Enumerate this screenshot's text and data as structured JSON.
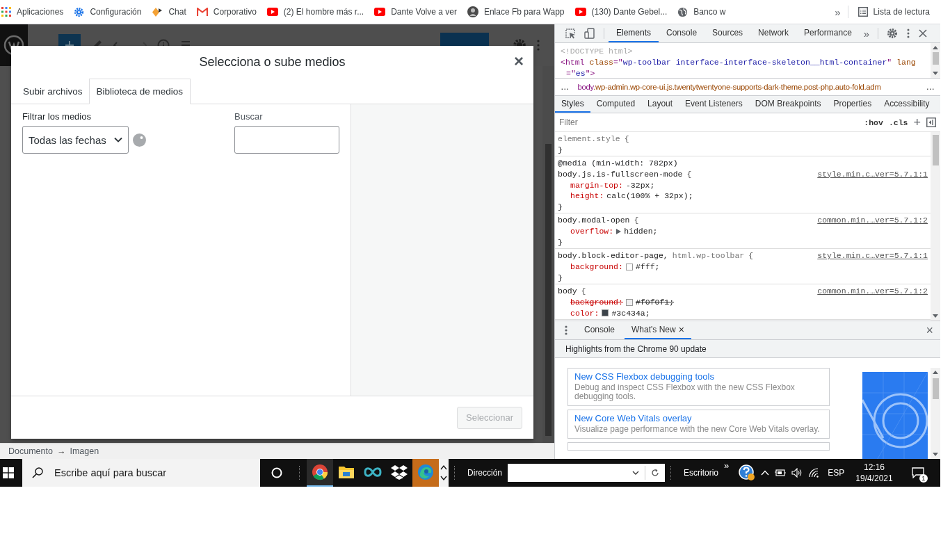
{
  "bookmarks": {
    "items": [
      {
        "label": "Aplicaciones",
        "kind": "grid"
      },
      {
        "label": "Configuración",
        "kind": "gear"
      },
      {
        "label": "Chat",
        "kind": "chat"
      },
      {
        "label": "Corporativo",
        "kind": "mail"
      },
      {
        "label": "(2) El hombre más r...",
        "kind": "video"
      },
      {
        "label": "Dante Volve a ver",
        "kind": "video"
      },
      {
        "label": "Enlace Fb para Wapp",
        "kind": "avatar"
      },
      {
        "label": "(130) Dante Gebel...",
        "kind": "video"
      },
      {
        "label": "Banco w",
        "kind": "globe"
      }
    ],
    "overflow": "»",
    "reading_list": "Lista de lectura"
  },
  "editor": {
    "breadcrumb": [
      "Documento",
      "→",
      "Imagen"
    ]
  },
  "modal": {
    "title": "Selecciona o sube medios",
    "close": "×",
    "tabs": [
      {
        "label": "Subir archivos",
        "selected": false
      },
      {
        "label": "Biblioteca de medios",
        "selected": true
      }
    ],
    "filter_label": "Filtrar los medios",
    "date_filter": "Todas las fechas",
    "search_label": "Buscar",
    "select_button": {
      "label": "Seleccionar",
      "disabled": true
    }
  },
  "devtools": {
    "tabs": [
      {
        "label": "Elements",
        "selected": true
      },
      {
        "label": "Console",
        "selected": false
      },
      {
        "label": "Sources",
        "selected": false
      },
      {
        "label": "Network",
        "selected": false
      },
      {
        "label": "Performance",
        "selected": false
      }
    ],
    "more": "»",
    "dom_lines": [
      [
        {
          "text": "<!DOCTYPE html>",
          "kind": "doctype"
        }
      ],
      [
        {
          "text": "<html ",
          "kind": "tag"
        },
        {
          "text": "class",
          "kind": "attr"
        },
        {
          "text": "=\"",
          "kind": "tag"
        },
        {
          "text": "wp-toolbar interface-interface-skeleton__html-container",
          "kind": "value"
        },
        {
          "text": "\" ",
          "kind": "tag"
        },
        {
          "text": "lang",
          "kind": "attr"
        },
        {
          "text": "=\"",
          "kind": "tag"
        },
        {
          "text": "es",
          "kind": "value"
        },
        {
          "text": "\">",
          "kind": "tag"
        }
      ]
    ],
    "breadcrumb": {
      "before": "…",
      "tokens": [
        {
          "text": "body",
          "kind": "tag"
        },
        {
          "text": ".wp-admin.wp-core-ui.js.twentytwentyone-supports-dark-theme.post-php.auto-fold.adm",
          "kind": "class"
        }
      ],
      "after": "…"
    },
    "style_tabs": [
      {
        "label": "Styles",
        "selected": true
      },
      {
        "label": "Computed",
        "selected": false
      },
      {
        "label": "Layout",
        "selected": false
      },
      {
        "label": "Event Listeners",
        "selected": false
      },
      {
        "label": "DOM Breakpoints",
        "selected": false
      },
      {
        "label": "Properties",
        "selected": false
      },
      {
        "label": "Accessibility",
        "selected": false
      }
    ],
    "filter": {
      "placeholder": "Filter"
    },
    "hov": ":hov",
    "cls": ".cls",
    "plus": "+",
    "rules": [
      {
        "selectors": [
          {
            "text": "element.style",
            "matched": false
          }
        ],
        "open": "{",
        "close": "}"
      },
      {
        "media": "@media (min-width: 782px)",
        "selectors": [
          {
            "text": "body.js.is-fullscreen-mode",
            "matched": true
          }
        ],
        "open": "{",
        "close": "}",
        "source": "style.min.c…ver=5.7.1:1",
        "props": [
          {
            "name": "margin-top:",
            "value": "-32px;",
            "kind": "plain",
            "struck": false
          },
          {
            "name": "height:",
            "value": "calc(100% + 32px);",
            "kind": "plain",
            "struck": false
          }
        ]
      },
      {
        "selectors": [
          {
            "text": "body.modal-open",
            "matched": true
          }
        ],
        "open": "{",
        "close": "}",
        "source": "common.min.…ver=5.7.1:2",
        "props": [
          {
            "name": "overflow:",
            "value": "hidden;",
            "kind": "expand",
            "struck": false
          }
        ]
      },
      {
        "selectors": [
          {
            "text": "body.block-editor-page,",
            "matched": true
          },
          {
            "text": "html.wp-toolbar",
            "matched": false
          }
        ],
        "open": "{",
        "close": "}",
        "source": "style.min.c…ver=5.7.1:1",
        "props": [
          {
            "name": "background:",
            "value": "#fff;",
            "kind": "swatch",
            "color": "#ffffff",
            "struck": false
          }
        ]
      },
      {
        "selectors": [
          {
            "text": "body",
            "matched": true
          }
        ],
        "open": "{",
        "source": "common.min.…ver=5.7.1:2",
        "props": [
          {
            "name": "background:",
            "value": "#f0f0f1;",
            "kind": "swatch",
            "color": "#f0f0f1",
            "struck": true
          },
          {
            "name": "color:",
            "value": "#3c434a;",
            "kind": "swatch",
            "color": "#3c434a",
            "struck": false
          }
        ]
      }
    ],
    "drawer": {
      "tabs": [
        {
          "label": "Console",
          "selected": false
        },
        {
          "label": "What's New",
          "selected": true,
          "close": "×"
        }
      ],
      "close": "×",
      "headline": "Highlights from the Chrome 90 update",
      "cards": [
        {
          "title": "New CSS Flexbox debugging tools",
          "text": "Debug and inspect CSS Flexbox with the new CSS Flexbox debugging tools."
        },
        {
          "title": "New Core Web Vitals overlay",
          "text": "Visualize page performance with the new Core Web Vitals overlay."
        }
      ]
    }
  },
  "taskbar": {
    "search_placeholder": "Escribe aquí para buscar",
    "apps": [
      {
        "kind": "chrome",
        "running": true,
        "highlighted": false
      },
      {
        "kind": "folder",
        "running": false,
        "highlighted": false
      },
      {
        "kind": "infinity",
        "running": false,
        "highlighted": false
      },
      {
        "kind": "dropbox",
        "running": false,
        "highlighted": false
      },
      {
        "kind": "edge",
        "running": false,
        "highlighted": true
      }
    ],
    "address_label": "Dirección",
    "desktop_label": "Escritorio",
    "more": "»",
    "lang": "ESP",
    "time": "12:16",
    "date": "19/4/2021",
    "notifications": "1"
  }
}
